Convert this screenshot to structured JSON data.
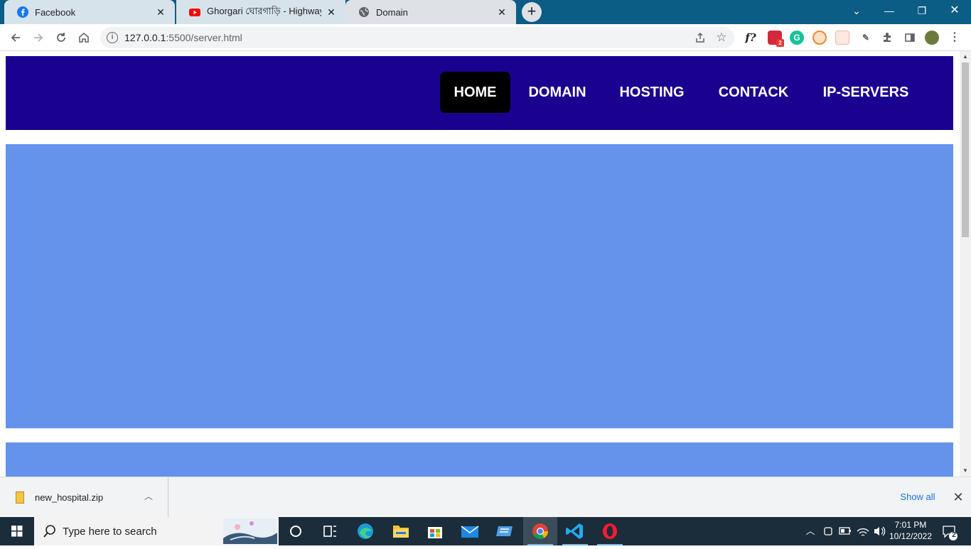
{
  "browser": {
    "tabs": [
      {
        "title": "Facebook",
        "icon": "facebook-icon",
        "active": false
      },
      {
        "title": "Ghorgari ঘোরগাড়ি - Highway (lyr",
        "icon": "youtube-icon",
        "active": false
      },
      {
        "title": "Domain",
        "icon": "globe-icon",
        "active": true
      }
    ],
    "address": {
      "host": "127.0.0.1",
      "path": ":5500/server.html"
    },
    "extensions": [
      {
        "name": "font-finder-icon",
        "label": "f?"
      },
      {
        "name": "extension-badge-icon",
        "label": "2"
      }
    ]
  },
  "page": {
    "nav": {
      "links": [
        {
          "label": "HOME",
          "active": true
        },
        {
          "label": "DOMAIN"
        },
        {
          "label": "HOSTING"
        },
        {
          "label": "CONTACK"
        },
        {
          "label": "IP-SERVERS"
        }
      ]
    },
    "colors": {
      "navbar": "#1a0190",
      "block": "#6593eb"
    }
  },
  "downloads": {
    "file_name": "new_hospital.zip",
    "show_all_label": "Show all"
  },
  "taskbar": {
    "search_placeholder": "Type here to search",
    "time": "7:01 PM",
    "date": "10/12/2022",
    "notifications": "2"
  }
}
